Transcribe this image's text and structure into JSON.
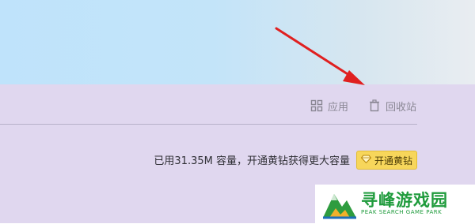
{
  "toolbar": {
    "apps_label": "应用",
    "recycle_label": "回收站"
  },
  "storage": {
    "quota_text": "已用31.35M 容量，开通黄钻获得更大容量",
    "upgrade_label": "开通黄钻"
  },
  "watermark": {
    "title": "寻峰游戏园",
    "subtitle": "PEAK SEARCH GAME PARK"
  },
  "colors": {
    "panel_bg": "#e0d7ef",
    "banner_bg": "#c3e4f9",
    "arrow": "#e02020",
    "upgrade_button": "#f7d65b",
    "watermark_green": "#1f9b3c"
  },
  "icons": {
    "apps": "grid-icon",
    "recycle": "trash-icon",
    "upgrade": "diamond-icon",
    "annotation": "red-arrow-icon"
  }
}
